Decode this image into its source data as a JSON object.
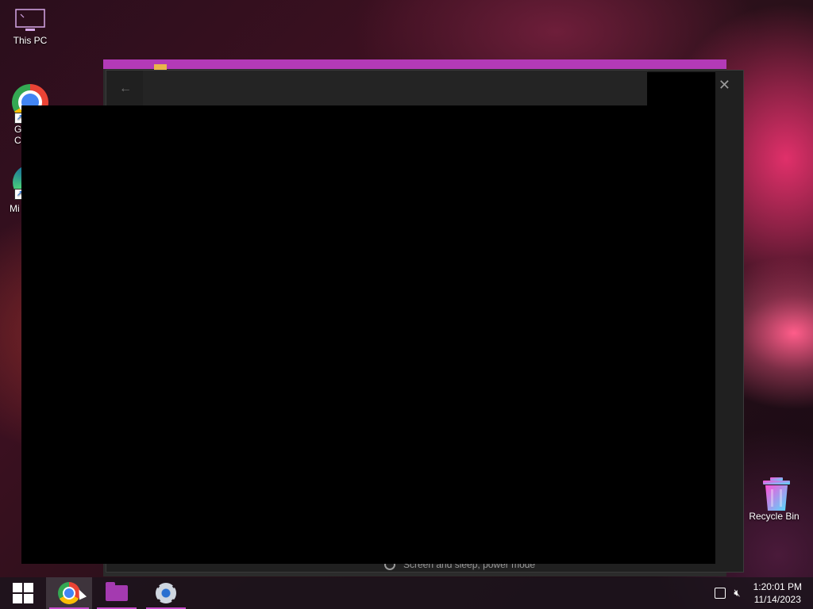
{
  "desktop": {
    "this_pc_label": "This PC",
    "chrome_label_fragment": "G\nC",
    "edge_label_fragment": "Mi",
    "recycle_bin_label": "Recycle Bin"
  },
  "settings_window": {
    "back_glyph": "←",
    "close_glyph": "✕",
    "partial_item_text": "Screen and sleep, power mode"
  },
  "taskbar": {
    "items": [
      {
        "name": "start",
        "icon": "windows-logo-icon"
      },
      {
        "name": "chrome",
        "icon": "chrome-icon",
        "active": true
      },
      {
        "name": "file-explorer",
        "icon": "folder-icon"
      },
      {
        "name": "settings",
        "icon": "gear-icon"
      }
    ]
  },
  "tray": {
    "time": "1:20:01 PM",
    "date": "11/14/2023"
  },
  "colors": {
    "accent": "#c54cc9",
    "window_border": "#b33ab7"
  }
}
